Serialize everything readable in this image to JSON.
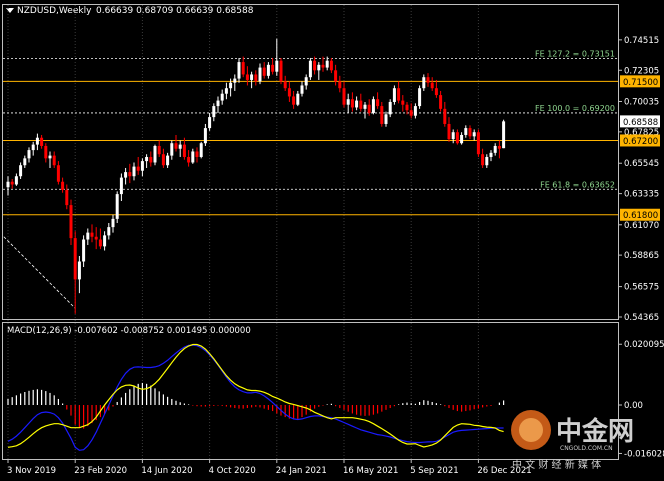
{
  "header": {
    "title": "NZDUSD,Weekly",
    "ohlc": "0.66639 0.68709 0.66639 0.68588"
  },
  "macd_header": "MACD(12,26,9) -0.007602 -0.008752 0.001495 0.000000",
  "watermark": {
    "brand": "中金网",
    "url": "CNGOLD.COM.CN",
    "slogan": "中 文 财 经 新 媒 体"
  },
  "colors": {
    "bull": "#ffffff",
    "bear": "#ff0000",
    "grid": "#ffffff",
    "fib_line": "#ffffff",
    "fib_text": "#8fd68f",
    "level_line": "#ffb400",
    "price_tag_bg": "#ffb400",
    "macd_line": "#1a1aff",
    "signal_line": "#ffff00",
    "trend_line": "#ffffff"
  },
  "chart_data": [
    {
      "type": "candlestick",
      "title": "NZDUSD,Weekly",
      "ylim": [
        0.54365,
        0.75959
      ],
      "y_ticks": [
        0.74515,
        0.72305,
        0.70035,
        0.67825,
        0.65545,
        0.63335,
        0.6107,
        0.58865,
        0.56575,
        0.54365
      ],
      "y_tick_labels": [
        "0.74515",
        "0.72305",
        "0.70035",
        "0.67825",
        "0.65545",
        "0.63335",
        "0.61070",
        "0.58865",
        "0.56575",
        "0.54365"
      ],
      "x_tick_labels": [
        "3 Nov 2019",
        "23 Feb 2020",
        "14 Jun 2020",
        "4 Oct 2020",
        "24 Jan 2021",
        "16 May 2021",
        "5 Sep 2021",
        "26 Dec 2021"
      ],
      "x_tick_bars": [
        0,
        16,
        32,
        48,
        64,
        80,
        96,
        112
      ],
      "fib_levels": [
        {
          "label": "FE 127.2 = 0.73151",
          "value": 0.73151
        },
        {
          "label": "FE 100.0 = 0.69200",
          "value": 0.692
        },
        {
          "label": "FE 61.8 = 0.63652",
          "value": 0.63652
        }
      ],
      "horizontal_levels": [
        {
          "label": "0.71500",
          "value": 0.715
        },
        {
          "label": "0.67200",
          "value": 0.672
        },
        {
          "label": "0.61800",
          "value": 0.618
        }
      ],
      "current_price": {
        "label": "0.68588",
        "value": 0.68588
      },
      "trend_line": {
        "from": [
          -1,
          0.602
        ],
        "to": [
          16,
          0.55
        ]
      },
      "candles": [
        [
          0.638,
          0.646,
          0.632,
          0.642
        ],
        [
          0.642,
          0.644,
          0.637,
          0.64
        ],
        [
          0.64,
          0.648,
          0.639,
          0.646
        ],
        [
          0.646,
          0.656,
          0.644,
          0.654
        ],
        [
          0.654,
          0.661,
          0.652,
          0.659
        ],
        [
          0.659,
          0.667,
          0.656,
          0.665
        ],
        [
          0.665,
          0.671,
          0.661,
          0.669
        ],
        [
          0.669,
          0.677,
          0.665,
          0.674
        ],
        [
          0.674,
          0.676,
          0.666,
          0.668
        ],
        [
          0.668,
          0.67,
          0.656,
          0.659
        ],
        [
          0.659,
          0.664,
          0.652,
          0.661
        ],
        [
          0.661,
          0.664,
          0.652,
          0.654
        ],
        [
          0.654,
          0.657,
          0.64,
          0.642
        ],
        [
          0.642,
          0.645,
          0.634,
          0.636
        ],
        [
          0.636,
          0.64,
          0.622,
          0.625
        ],
        [
          0.625,
          0.629,
          0.596,
          0.601
        ],
        [
          0.601,
          0.606,
          0.546,
          0.571
        ],
        [
          0.571,
          0.588,
          0.561,
          0.584
        ],
        [
          0.584,
          0.603,
          0.58,
          0.6
        ],
        [
          0.6,
          0.608,
          0.596,
          0.605
        ],
        [
          0.605,
          0.611,
          0.598,
          0.602
        ],
        [
          0.602,
          0.609,
          0.593,
          0.6
        ],
        [
          0.6,
          0.608,
          0.593,
          0.595
        ],
        [
          0.595,
          0.606,
          0.592,
          0.603
        ],
        [
          0.603,
          0.612,
          0.6,
          0.609
        ],
        [
          0.609,
          0.618,
          0.605,
          0.615
        ],
        [
          0.615,
          0.635,
          0.612,
          0.633
        ],
        [
          0.633,
          0.648,
          0.628,
          0.645
        ],
        [
          0.645,
          0.652,
          0.64,
          0.649
        ],
        [
          0.649,
          0.655,
          0.641,
          0.646
        ],
        [
          0.646,
          0.656,
          0.643,
          0.653
        ],
        [
          0.653,
          0.66,
          0.647,
          0.65
        ],
        [
          0.65,
          0.659,
          0.646,
          0.657
        ],
        [
          0.657,
          0.662,
          0.652,
          0.66
        ],
        [
          0.66,
          0.664,
          0.653,
          0.656
        ],
        [
          0.656,
          0.669,
          0.654,
          0.668
        ],
        [
          0.668,
          0.672,
          0.66,
          0.662
        ],
        [
          0.662,
          0.666,
          0.652,
          0.654
        ],
        [
          0.654,
          0.663,
          0.652,
          0.661
        ],
        [
          0.661,
          0.672,
          0.658,
          0.67
        ],
        [
          0.67,
          0.676,
          0.664,
          0.666
        ],
        [
          0.666,
          0.672,
          0.66,
          0.669
        ],
        [
          0.669,
          0.674,
          0.658,
          0.66
        ],
        [
          0.66,
          0.665,
          0.653,
          0.656
        ],
        [
          0.656,
          0.666,
          0.655,
          0.664
        ],
        [
          0.664,
          0.667,
          0.656,
          0.66
        ],
        [
          0.66,
          0.671,
          0.659,
          0.67
        ],
        [
          0.67,
          0.684,
          0.668,
          0.681
        ],
        [
          0.681,
          0.692,
          0.679,
          0.689
        ],
        [
          0.689,
          0.699,
          0.686,
          0.697
        ],
        [
          0.697,
          0.704,
          0.692,
          0.701
        ],
        [
          0.701,
          0.709,
          0.698,
          0.706
        ],
        [
          0.706,
          0.714,
          0.702,
          0.71
        ],
        [
          0.71,
          0.717,
          0.704,
          0.714
        ],
        [
          0.714,
          0.72,
          0.708,
          0.717
        ],
        [
          0.717,
          0.732,
          0.714,
          0.729
        ],
        [
          0.729,
          0.733,
          0.718,
          0.72
        ],
        [
          0.72,
          0.726,
          0.712,
          0.716
        ],
        [
          0.716,
          0.722,
          0.71,
          0.72
        ],
        [
          0.72,
          0.723,
          0.712,
          0.715
        ],
        [
          0.715,
          0.728,
          0.713,
          0.725
        ],
        [
          0.725,
          0.729,
          0.717,
          0.719
        ],
        [
          0.719,
          0.729,
          0.717,
          0.727
        ],
        [
          0.727,
          0.732,
          0.72,
          0.722
        ],
        [
          0.722,
          0.746,
          0.719,
          0.73
        ],
        [
          0.73,
          0.732,
          0.713,
          0.715
        ],
        [
          0.715,
          0.719,
          0.708,
          0.71
        ],
        [
          0.71,
          0.715,
          0.7,
          0.704
        ],
        [
          0.704,
          0.708,
          0.695,
          0.698
        ],
        [
          0.698,
          0.708,
          0.697,
          0.706
        ],
        [
          0.706,
          0.715,
          0.704,
          0.712
        ],
        [
          0.712,
          0.72,
          0.709,
          0.718
        ],
        [
          0.718,
          0.732,
          0.716,
          0.73
        ],
        [
          0.73,
          0.733,
          0.72,
          0.723
        ],
        [
          0.723,
          0.729,
          0.716,
          0.727
        ],
        [
          0.727,
          0.733,
          0.722,
          0.725
        ],
        [
          0.725,
          0.733,
          0.723,
          0.73
        ],
        [
          0.73,
          0.732,
          0.721,
          0.723
        ],
        [
          0.723,
          0.727,
          0.712,
          0.715
        ],
        [
          0.715,
          0.719,
          0.707,
          0.71
        ],
        [
          0.71,
          0.715,
          0.696,
          0.698
        ],
        [
          0.698,
          0.706,
          0.692,
          0.702
        ],
        [
          0.702,
          0.707,
          0.693,
          0.696
        ],
        [
          0.696,
          0.704,
          0.694,
          0.701
        ],
        [
          0.701,
          0.706,
          0.693,
          0.695
        ],
        [
          0.695,
          0.7,
          0.688,
          0.698
        ],
        [
          0.698,
          0.702,
          0.69,
          0.692
        ],
        [
          0.692,
          0.704,
          0.691,
          0.702
        ],
        [
          0.702,
          0.707,
          0.695,
          0.697
        ],
        [
          0.697,
          0.7,
          0.682,
          0.684
        ],
        [
          0.684,
          0.693,
          0.682,
          0.691
        ],
        [
          0.691,
          0.702,
          0.689,
          0.7
        ],
        [
          0.7,
          0.712,
          0.698,
          0.71
        ],
        [
          0.71,
          0.715,
          0.699,
          0.701
        ],
        [
          0.701,
          0.705,
          0.693,
          0.698
        ],
        [
          0.698,
          0.7,
          0.691,
          0.694
        ],
        [
          0.694,
          0.699,
          0.688,
          0.69
        ],
        [
          0.69,
          0.699,
          0.688,
          0.697
        ],
        [
          0.697,
          0.712,
          0.695,
          0.71
        ],
        [
          0.71,
          0.72,
          0.708,
          0.718
        ],
        [
          0.718,
          0.721,
          0.711,
          0.714
        ],
        [
          0.714,
          0.718,
          0.708,
          0.71
        ],
        [
          0.71,
          0.716,
          0.703,
          0.705
        ],
        [
          0.705,
          0.708,
          0.693,
          0.695
        ],
        [
          0.695,
          0.7,
          0.682,
          0.684
        ],
        [
          0.684,
          0.689,
          0.671,
          0.673
        ],
        [
          0.673,
          0.68,
          0.67,
          0.678
        ],
        [
          0.678,
          0.68,
          0.669,
          0.67
        ],
        [
          0.67,
          0.678,
          0.669,
          0.676
        ],
        [
          0.676,
          0.683,
          0.674,
          0.681
        ],
        [
          0.681,
          0.683,
          0.673,
          0.675
        ],
        [
          0.675,
          0.68,
          0.672,
          0.678
        ],
        [
          0.678,
          0.68,
          0.66,
          0.662
        ],
        [
          0.662,
          0.666,
          0.652,
          0.654
        ],
        [
          0.654,
          0.662,
          0.652,
          0.66
        ],
        [
          0.66,
          0.665,
          0.657,
          0.663
        ],
        [
          0.663,
          0.67,
          0.661,
          0.668
        ],
        [
          0.668,
          0.672,
          0.659,
          0.666
        ],
        [
          0.6664,
          0.6871,
          0.6664,
          0.6859
        ]
      ]
    },
    {
      "type": "macd",
      "title": "MACD(12,26,9)",
      "ylim": [
        -0.0172,
        0.0215
      ],
      "y_tick_labels": [
        "0.020095",
        "0.00",
        "-0.016028"
      ],
      "y_ticks": [
        0.020095,
        0.0,
        -0.016028
      ],
      "histogram": [
        0.002,
        0.0026,
        0.0032,
        0.0038,
        0.0043,
        0.0047,
        0.005,
        0.0052,
        0.005,
        0.0046,
        0.004,
        0.0032,
        0.002,
        0.0005,
        -0.0015,
        -0.0035,
        -0.0065,
        -0.0075,
        -0.0078,
        -0.007,
        -0.006,
        -0.005,
        -0.004,
        -0.003,
        -0.0018,
        -0.0005,
        0.001,
        0.0025,
        0.004,
        0.0052,
        0.0062,
        0.007,
        0.0073,
        0.007,
        0.0064,
        0.0055,
        0.0045,
        0.0035,
        0.0027,
        0.002,
        0.0014,
        0.0009,
        0.0005,
        0.0002,
        -0.0002,
        -0.0004,
        -0.0005,
        -0.0005,
        -0.0004,
        -0.0003,
        -0.0002,
        -0.0003,
        -0.0005,
        -0.0008,
        -0.001,
        -0.0012,
        -0.0012,
        -0.001,
        -0.0008,
        -0.0006,
        -0.0008,
        -0.0012,
        -0.0016,
        -0.002,
        -0.0028,
        -0.0035,
        -0.004,
        -0.0045,
        -0.0048,
        -0.0046,
        -0.004,
        -0.0032,
        -0.0022,
        -0.0012,
        -0.0006,
        -0.0002,
        0.0002,
        0.0004,
        -0.0004,
        -0.001,
        -0.0016,
        -0.0022,
        -0.0028,
        -0.0032,
        -0.0035,
        -0.0036,
        -0.0035,
        -0.0032,
        -0.0028,
        -0.0022,
        -0.0016,
        -0.001,
        -0.0004,
        0.0002,
        0.0006,
        0.0008,
        0.0006,
        0.0004,
        0.001,
        0.0016,
        0.0014,
        0.001,
        0.0006,
        0.0002,
        -0.0004,
        -0.001,
        -0.0016,
        -0.002,
        -0.0022,
        -0.002,
        -0.0018,
        -0.0014,
        -0.0012,
        -0.0008,
        -0.0005,
        -0.0003,
        0.0,
        0.0008,
        0.0015
      ],
      "macd": [
        -0.012,
        -0.0113,
        -0.0103,
        -0.009,
        -0.0075,
        -0.006,
        -0.0045,
        -0.0032,
        -0.0025,
        -0.0023,
        -0.0025,
        -0.003,
        -0.0042,
        -0.006,
        -0.0085,
        -0.011,
        -0.014,
        -0.015,
        -0.0148,
        -0.0135,
        -0.0115,
        -0.009,
        -0.006,
        -0.003,
        0.0,
        0.003,
        0.006,
        0.0085,
        0.0105,
        0.0118,
        0.0125,
        0.0126,
        0.0125,
        0.0124,
        0.0124,
        0.0126,
        0.013,
        0.0138,
        0.0148,
        0.016,
        0.0172,
        0.0183,
        0.0192,
        0.0197,
        0.0198,
        0.0196,
        0.019,
        0.018,
        0.0166,
        0.015,
        0.0132,
        0.0112,
        0.0092,
        0.0074,
        0.006,
        0.005,
        0.0044,
        0.004,
        0.004,
        0.0042,
        0.0038,
        0.003,
        0.002,
        0.0008,
        -0.0005,
        -0.0018,
        -0.003,
        -0.004,
        -0.0046,
        -0.0048,
        -0.0046,
        -0.0042,
        -0.0038,
        -0.0036,
        -0.0036,
        -0.0038,
        -0.004,
        -0.0042,
        -0.0046,
        -0.0052,
        -0.0058,
        -0.0064,
        -0.007,
        -0.0076,
        -0.0082,
        -0.0086,
        -0.009,
        -0.0094,
        -0.0098,
        -0.01,
        -0.0103,
        -0.0106,
        -0.011,
        -0.0114,
        -0.0118,
        -0.0121,
        -0.0123,
        -0.0124,
        -0.0124,
        -0.0123,
        -0.0122,
        -0.0122,
        -0.012,
        -0.0114,
        -0.0106,
        -0.0098,
        -0.009,
        -0.0086,
        -0.0084,
        -0.0083,
        -0.0082,
        -0.0081,
        -0.008,
        -0.0079,
        -0.0078,
        -0.0077,
        -0.0076,
        -0.0076,
        -0.0076
      ],
      "signal": [
        -0.014,
        -0.0138,
        -0.0135,
        -0.0128,
        -0.0118,
        -0.0107,
        -0.0095,
        -0.0084,
        -0.0075,
        -0.0069,
        -0.0065,
        -0.0062,
        -0.0062,
        -0.0065,
        -0.007,
        -0.0075,
        -0.0075,
        -0.0075,
        -0.007,
        -0.0065,
        -0.0055,
        -0.004,
        -0.002,
        0.0,
        0.0018,
        0.0035,
        0.005,
        0.006,
        0.0065,
        0.0066,
        0.0063,
        0.0056,
        0.0052,
        0.0054,
        0.006,
        0.0071,
        0.0085,
        0.0103,
        0.0121,
        0.014,
        0.0158,
        0.0174,
        0.0187,
        0.0195,
        0.02,
        0.02,
        0.0195,
        0.0185,
        0.017,
        0.0153,
        0.0134,
        0.0115,
        0.0097,
        0.0082,
        0.007,
        0.0062,
        0.0056,
        0.005,
        0.0048,
        0.0048,
        0.0046,
        0.0042,
        0.0036,
        0.0028,
        0.0023,
        0.0017,
        0.001,
        0.0005,
        0.0002,
        -0.0002,
        -0.0006,
        -0.001,
        -0.0016,
        -0.0024,
        -0.003,
        -0.0036,
        -0.0042,
        -0.0046,
        -0.0042,
        -0.0042,
        -0.0042,
        -0.0042,
        -0.0042,
        -0.0044,
        -0.0047,
        -0.005,
        -0.0055,
        -0.0062,
        -0.007,
        -0.0078,
        -0.0087,
        -0.0096,
        -0.0106,
        -0.0116,
        -0.0124,
        -0.0129,
        -0.0129,
        -0.0128,
        -0.0134,
        -0.0139,
        -0.0136,
        -0.0132,
        -0.0126,
        -0.0116,
        -0.0102,
        -0.0088,
        -0.0074,
        -0.0066,
        -0.0062,
        -0.0063,
        -0.0064,
        -0.0067,
        -0.0068,
        -0.0071,
        -0.0073,
        -0.0074,
        -0.0076,
        -0.0084,
        -0.0088
      ]
    }
  ]
}
